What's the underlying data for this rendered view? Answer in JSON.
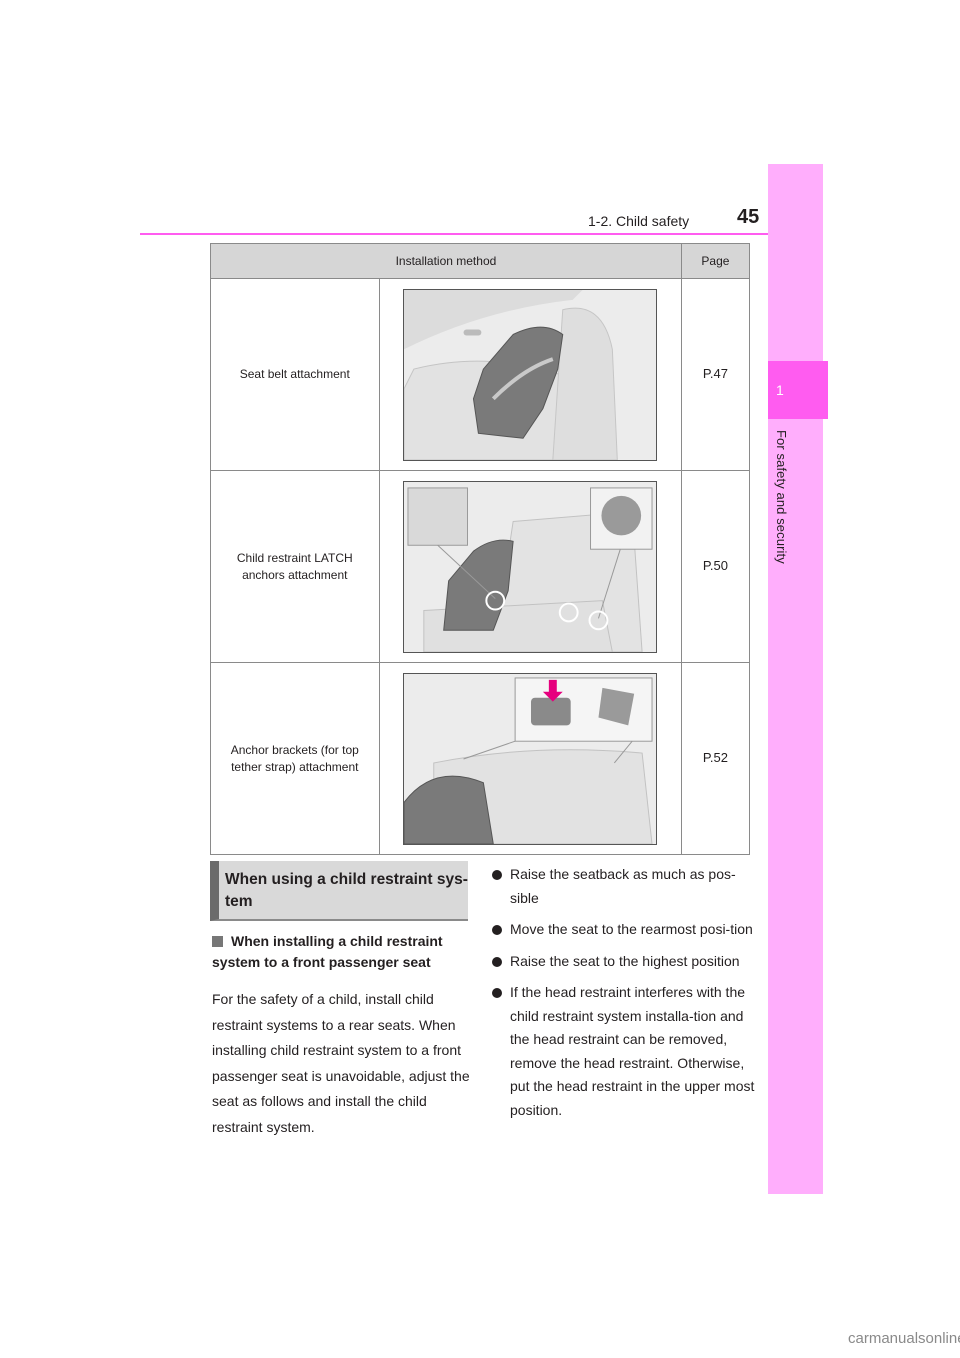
{
  "header": {
    "section": "1-2. Child safety",
    "page_number": "45"
  },
  "side_tab": {
    "chapter_number": "1",
    "chapter_label": "For safety and security"
  },
  "table": {
    "columns": [
      "Installation method",
      "Page"
    ],
    "rows": [
      {
        "method": "Seat belt attachment",
        "illustration": "child-seat-seat-belt-illustration",
        "page": "P.47"
      },
      {
        "method": "Child restraint LATCH anchors attachment",
        "illustration": "child-seat-latch-anchors-illustration",
        "page": "P.50"
      },
      {
        "method": "Anchor brackets (for top tether strap) attachment",
        "illustration": "child-seat-top-tether-illustration",
        "page": "P.52"
      }
    ]
  },
  "section": {
    "title": "When using a child restraint sys-tem",
    "subheading": "When installing a child restraint system to a front passenger seat",
    "paragraph": "For the safety of a child, install child restraint systems to a rear seats. When installing child restraint system to a front passenger seat is unavoidable, adjust the seat as follows and install the child restraint system.",
    "bullets": [
      "Raise the seatback as much as pos-sible",
      "Move the seat to the rearmost posi-tion",
      "Raise the seat to the highest position",
      "If the head restraint interferes with the child restraint system installa-tion and the head restraint can be removed, remove the head restraint. Otherwise, put the head restraint in the upper most position."
    ]
  },
  "colors": {
    "accent_pink": "#ff5cf0",
    "tab_pink": "#ffaefc",
    "arrow_magenta": "#e6007e"
  },
  "watermark": "carmanualsonline.info"
}
